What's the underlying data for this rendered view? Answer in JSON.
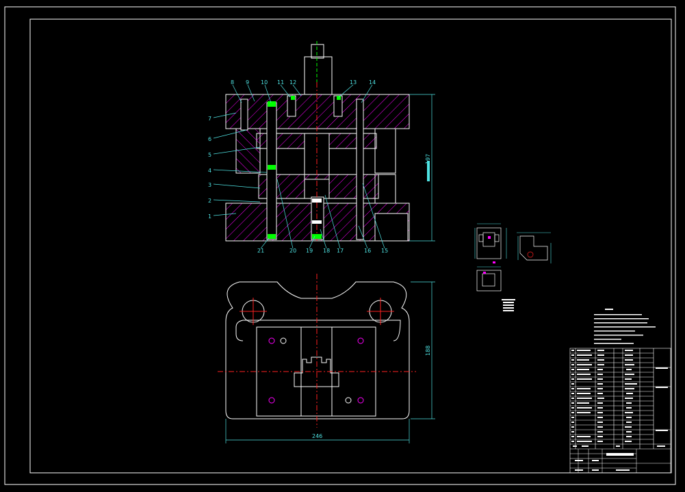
{
  "drawing": {
    "colors": {
      "background": "#000000",
      "outline": "#ffffff",
      "hatch": "#ff00ff",
      "centerline": "#ff2020",
      "dimension": "#4fe3e3",
      "highlight": "#00ff00",
      "yellow": "#ffff00"
    },
    "dimensions": {
      "height_front": "197",
      "height_plan": "188",
      "width_plan": "246"
    },
    "part_labels": [
      "1",
      "2",
      "3",
      "4",
      "5",
      "6",
      "7",
      "8",
      "9",
      "10",
      "11",
      "12",
      "13",
      "14",
      "15",
      "16",
      "17",
      "18",
      "19",
      "20",
      "21"
    ]
  }
}
